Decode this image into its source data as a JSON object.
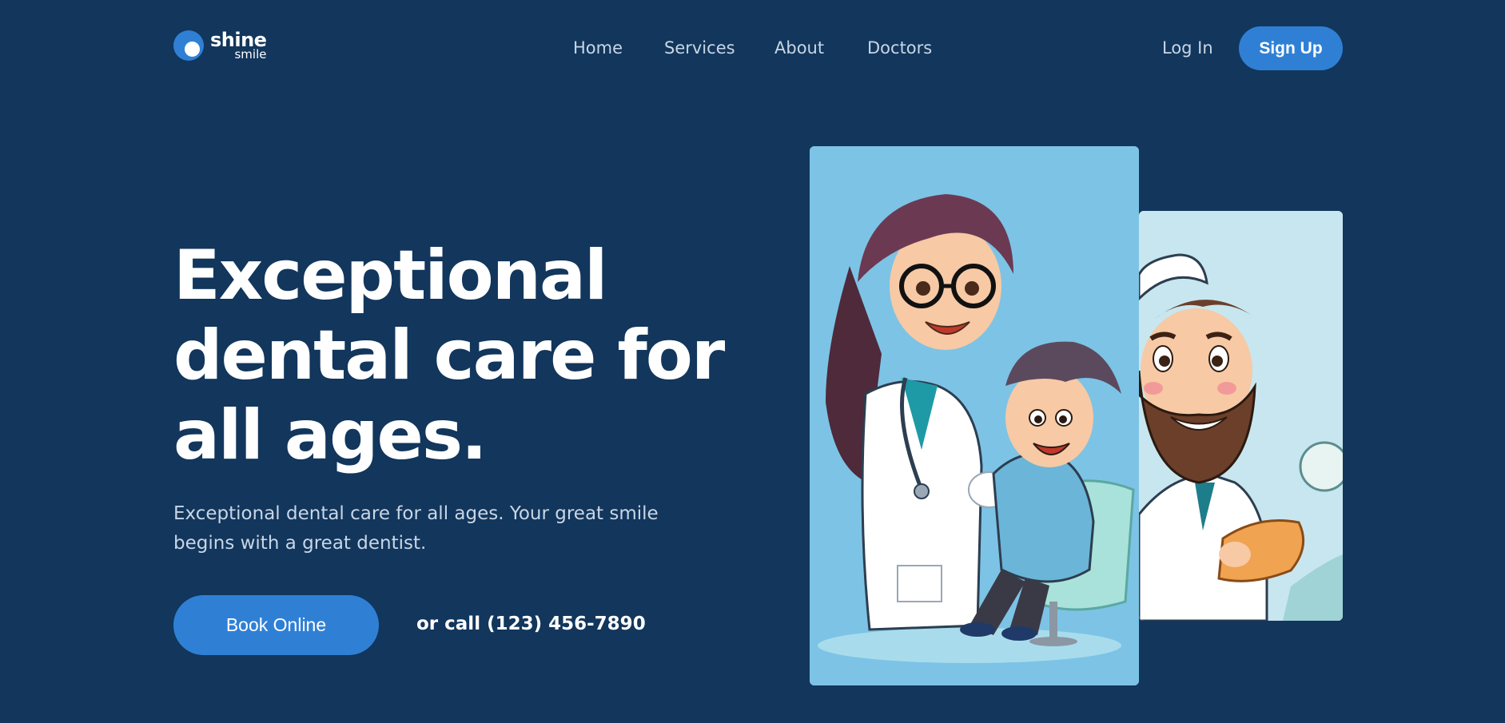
{
  "brand": {
    "name": "shine",
    "tagline": "smile"
  },
  "nav": {
    "items": [
      {
        "label": "Home"
      },
      {
        "label": "Services"
      },
      {
        "label": "About"
      },
      {
        "label": "Doctors"
      }
    ],
    "login_label": "Log In",
    "signup_label": "Sign Up"
  },
  "hero": {
    "headline": "Exceptional dental care for all ages.",
    "subtitle": "Exceptional dental care for all ages. Your great smile begins with a great dentist.",
    "book_label": "Book Online",
    "call_text": "or call (123) 456-7890"
  },
  "images": {
    "front": "female-dentist-with-child-illustration",
    "back": "bearded-dentist-illustration"
  },
  "colors": {
    "background": "#12365c",
    "accent": "#2f80d5",
    "muted_text": "#c8d6e6",
    "card_front": "#7dc3e5",
    "card_back": "#c8e6ef"
  }
}
